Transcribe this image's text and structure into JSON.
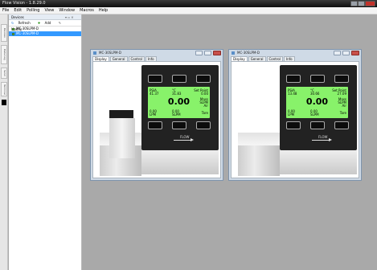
{
  "app": {
    "title": "Flow Vision - 1.8.29.0"
  },
  "menu": [
    "File",
    "Edit",
    "Polling",
    "View",
    "Window",
    "Macros",
    "Help"
  ],
  "sidebar": {
    "panel_title": "Devices",
    "panel_controls": "▾ ▫ ✕",
    "tools": {
      "refresh": "Refresh",
      "add": "Add",
      "modify": "Modify"
    },
    "vtabs": [
      "Devices",
      "Data Log",
      "Send",
      "Terminal"
    ],
    "items": [
      {
        "label": "MC-30SLPM-D"
      },
      {
        "label": "MC-30SLPM-D"
      }
    ]
  },
  "windows": [
    {
      "title": "MC-30SLPM-D",
      "tabs": [
        "Display",
        "General",
        "Control",
        "Info"
      ],
      "lcd": {
        "tl_label": "PSIA",
        "tl_value": "41.37",
        "tc_label": "°C",
        "tc_value": "31.83",
        "tr_label": "Set Point",
        "tr_value": "0.00",
        "main_value": "0.00",
        "mass_label": "Mass",
        "mass_unit": "SLPM",
        "gas": "Air",
        "bl_value": "0.00",
        "bl_unit": "LPM",
        "bc_value": "0.00",
        "bc_unit": "SLPM",
        "br_label": "Tare"
      },
      "flow_label": "FLOW"
    },
    {
      "title": "MC-30SLPM-D",
      "tabs": [
        "Display",
        "General",
        "Control",
        "Info"
      ],
      "lcd": {
        "tl_label": "PSIA",
        "tl_value": "13.48",
        "tc_label": "°C",
        "tc_value": "30.66",
        "tr_label": "Set Point",
        "tr_value": "27.09",
        "main_value": "0.00",
        "mass_label": "Mass",
        "mass_unit": "SLPM",
        "gas": "Air",
        "bl_value": "0.00",
        "bl_unit": "LPM",
        "bc_value": "0.00",
        "bc_unit": "SLPM",
        "br_label": "Tare"
      },
      "flow_label": "FLOW"
    }
  ]
}
